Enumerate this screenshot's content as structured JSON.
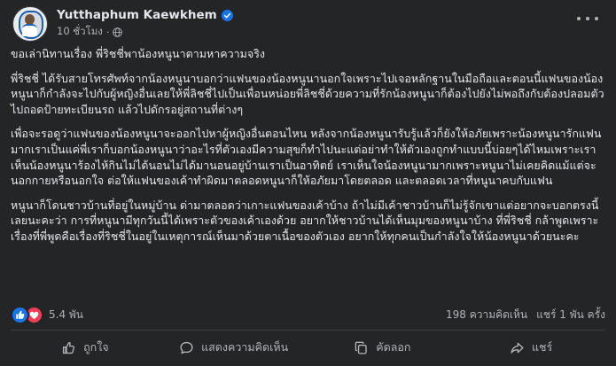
{
  "post": {
    "author_name": "Yutthaphum Kaewkhem",
    "time": "10 ชั่วโมง",
    "dot": "·",
    "paragraphs": [
      "ขอเล่านิทานเรื่อง พี่ริชชี่พาน้องหนูนาตามหาความจริง",
      "พี่ริชชี่ ได้รับสายโทรศัพท์จากน้องหนูนาบอกว่าแฟนของน้องหนูนานอกใจเพราะไปเจอหลักฐานในมือถือและตอนนี้แฟนของน้องหนูนาก็กำลังจะไปกับผู้หญิงอื่นเลยให้พี่ลิชชี่ไปเป็นเพื่อนหน่อยพี่ลิชชี่ด้วยความที่รักน้องหนูนาก็ต้องไปยังไม่พอถึงกับต้องปลอมตัวไปถอดป้ายทะเบียนรถ แล้วไปดักรอยู่สถานที่ต่างๆ",
      "เพื่อจะรอดูว่าแฟนของน้องหนูนาจะออกไปหาผู้หญิงอื่นตอนไหน หลังจากน้องหนูนารับรู้แล้วก็ยังให้อภัยเพราะน้องหนูนารักแฟนมากเราเป็นแค่พี่เราก็บอกน้องหนูนาว่าอะไรที่ตัวเองมีความสุขก็ทำไปนะแต่อย่าทำให้ตัวเองถูกทำแบบนี้บ่อยๆได้ไหมเพราะเราเห็นน้องหนูนาร้องไห้กินไม่ได้นอนไม่ได้มานอนอยู่บ้านเราเป็นอาทิตย์ เราเห็นใจน้องหนูนามากเพราะหนูนาไม่เคยคิดแม้แต่จะนอกกายหรือนอกใจ ต่อให้แฟนของเค้าทำผิดมาตลอดหนูนาก็ให้อภัยมาโดยตลอด และตลอดเวลาที่หนูนาคบกับแฟน",
      "หนูนาก็โดนชาวบ้านที่อยู่ในหมู่บ้าน ด่ามาตลอดว่าเกาะแฟนของเค้าบ้าง ถ้าไม่มีเค้าชาวบ้านก็ไม่รู้จักเขาแต่อยากจะบอกตรงนี้เลยนะคะว่า การที่หนูนามีทุกวันนี้ได้เพราะตัวของเค้าเองด้วย อยากให้ชาวบ้านได้เห็นมุมของหนูนาบ้าง ที่พี่ริชชี่ กล้าพูดเพราะเรื่องที่พี่พูดคือเรื่องที่ริชชี่ในอยู่ในเหตุการณ์เห็นมาด้วยตาเนื้อของตัวเอง อยากให้ทุกคนเป็นกำลังใจให้น้องหนูนาด้วยนะคะ"
    ],
    "reactions_count": "5.4 พัน",
    "comments_count": "198 ความคิดเห็น",
    "shares_count": "แชร์ 1 พัน ครั้ง",
    "actions": {
      "like": "ถูกใจ",
      "comment": "แสดงความคิดเห็น",
      "copy": "คัดลอก",
      "share": "แชร์"
    }
  },
  "icons": {
    "verified": "verified-badge-icon",
    "privacy": "globe-icon",
    "more": "more-options-icon",
    "like_reaction": "like-reaction-icon",
    "love_reaction": "love-reaction-icon",
    "like": "thumbs-up-icon",
    "comment": "comment-bubble-icon",
    "copy": "copy-icon",
    "share": "share-arrow-icon"
  },
  "colors": {
    "background": "#242526",
    "text": "#e4e6eb",
    "secondary_text": "#b0b3b8",
    "verified": "#1b74e4",
    "like": "#1b74e4",
    "love": "#f33e58"
  }
}
